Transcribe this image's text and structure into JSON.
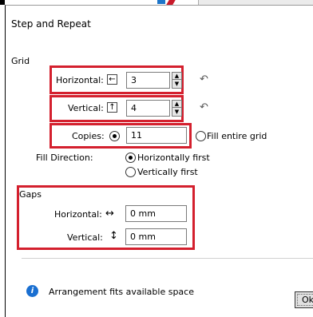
{
  "dialog": {
    "title": "Step and Repeat"
  },
  "grid": {
    "section_label": "Grid",
    "horizontal": {
      "label": "Horizontal:",
      "icon": "arrow-left-icon",
      "value": "3"
    },
    "vertical": {
      "label": "Vertical:",
      "icon": "arrow-up-icon",
      "value": "4"
    },
    "copies": {
      "label": "Copies:",
      "value": "11",
      "selected": true
    },
    "fill_entire_grid": {
      "label": "Fill entire grid",
      "selected": false
    },
    "fill_direction": {
      "label": "Fill Direction:",
      "options": [
        {
          "label": "Horizontally first",
          "selected": true
        },
        {
          "label": "Vertically first",
          "selected": false
        }
      ]
    }
  },
  "gaps": {
    "section_label": "Gaps",
    "horizontal": {
      "label": "Horizontal:",
      "icon": "horizontal-double-arrow-icon",
      "value": "0 mm"
    },
    "vertical": {
      "label": "Vertical:",
      "icon": "vertical-double-arrow-icon",
      "value": "0 mm"
    }
  },
  "footer": {
    "status": "Arrangement fits available space",
    "ok_label": "Ok"
  },
  "colors": {
    "highlight": "#d4202e",
    "info": "#1a6fd1"
  }
}
